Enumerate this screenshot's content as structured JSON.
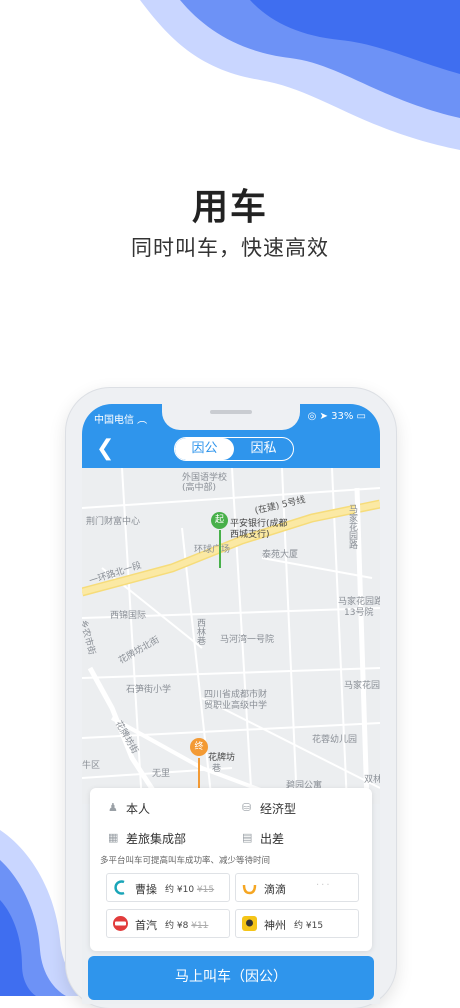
{
  "headline": {
    "title": "用车",
    "subtitle": "同时叫车，快速高效"
  },
  "status_bar": {
    "carrier": "中国电信",
    "battery": "33%"
  },
  "nav": {
    "tab_business": "因公",
    "tab_private": "因私"
  },
  "map": {
    "labels": [
      "外国语学校",
      "(高中部)",
      "(在建) 5号线",
      "平安银行(成都",
      "西城支行)",
      "环球广场",
      "泰苑大厦",
      "荆门财富中心",
      "一环路北一段",
      "马家花园路",
      "马家花园路",
      "13号院",
      "西锦国际",
      "乡农市街",
      "花牌坊北街",
      "西林巷",
      "马河湾一号院",
      "石笋街小学",
      "四川省成都市财",
      "贸职业高级中学",
      "马家花园",
      "花牌坊街",
      "花蓉幼儿园",
      "花牌坊",
      "巷",
      "无里",
      "碧园公寓",
      "双林",
      "牛区"
    ],
    "start_marker": "起",
    "end_marker": "终"
  },
  "options": {
    "passenger": "本人",
    "car_type": "经济型",
    "department": "差旅集成部",
    "reason": "出差",
    "hint": "多平台叫车可提高叫车成功率、减少等待时间"
  },
  "cars": [
    {
      "name": "曹操",
      "approx": "约",
      "price": "¥10",
      "old_price": "¥15"
    },
    {
      "name": "滴滴",
      "approx": "",
      "price": "",
      "old_price": ""
    },
    {
      "name": "首汽",
      "approx": "约",
      "price": "¥8",
      "old_price": "¥11"
    },
    {
      "name": "神州",
      "approx": "约",
      "price": "¥15",
      "old_price": ""
    }
  ],
  "cta": "马上叫车（因公）",
  "colors": {
    "primary": "#2f95ec",
    "wave_light": "#9ab4ff",
    "wave_dark": "#3f6ef0"
  }
}
